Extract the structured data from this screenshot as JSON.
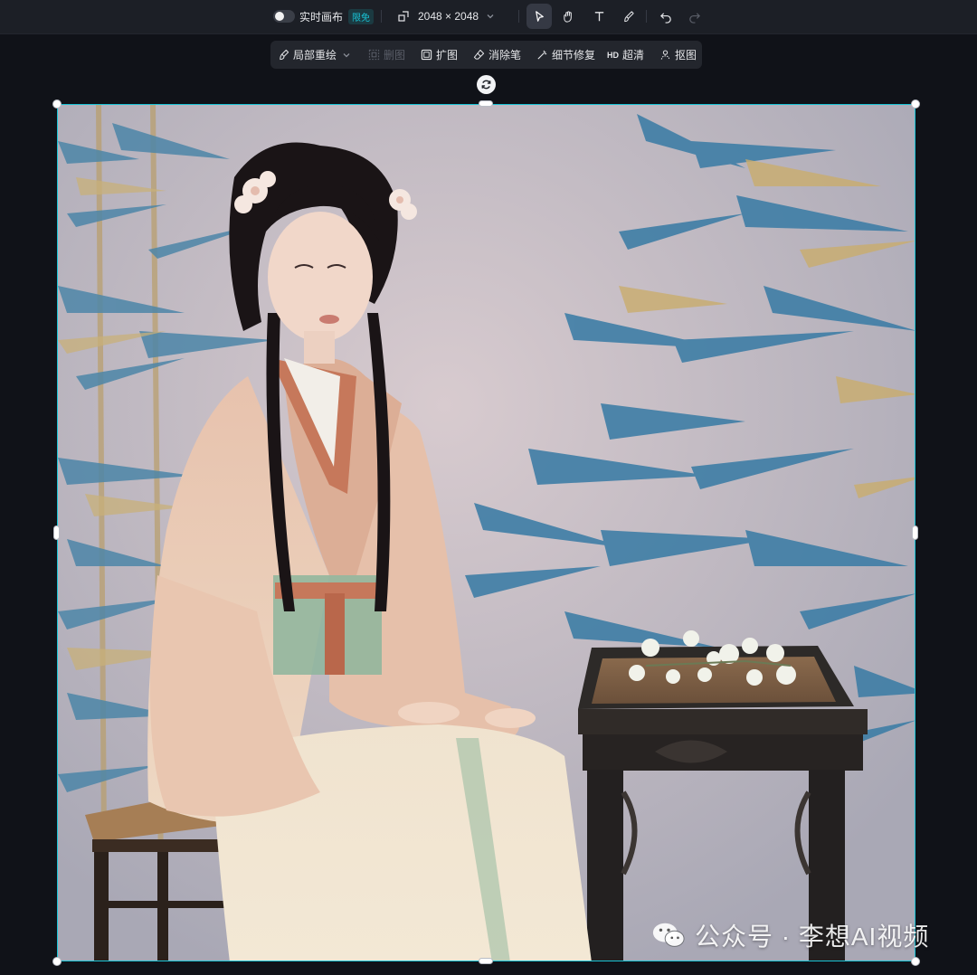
{
  "topbar": {
    "live_canvas_label": "实时画布",
    "live_canvas_badge": "限免",
    "canvas_size": "2048 × 2048",
    "tools": [
      "select-tool",
      "hand-tool",
      "text-tool",
      "brush-tool",
      "undo",
      "redo"
    ]
  },
  "subbar": {
    "items": [
      {
        "label": "局部重绘",
        "icon": "paint-brush-icon",
        "enabled": true,
        "has_dropdown": true
      },
      {
        "label": "删图",
        "icon": "delete-image-icon",
        "enabled": false
      },
      {
        "label": "扩图",
        "icon": "expand-icon",
        "enabled": true
      },
      {
        "label": "消除笔",
        "icon": "eraser-icon",
        "enabled": true
      },
      {
        "label": "细节修复",
        "icon": "magic-wand-icon",
        "enabled": true
      },
      {
        "label": "超清",
        "prefix": "HD",
        "icon": "hd-icon",
        "enabled": true
      },
      {
        "label": "抠图",
        "icon": "cutout-icon",
        "enabled": true
      }
    ]
  },
  "canvas": {
    "accent": "#19c4d6",
    "image_alt": "Hanfu woman seated beside a carved wooden table with bamboo backdrop"
  },
  "watermark": {
    "text": "公众号 · 李想AI视频"
  }
}
